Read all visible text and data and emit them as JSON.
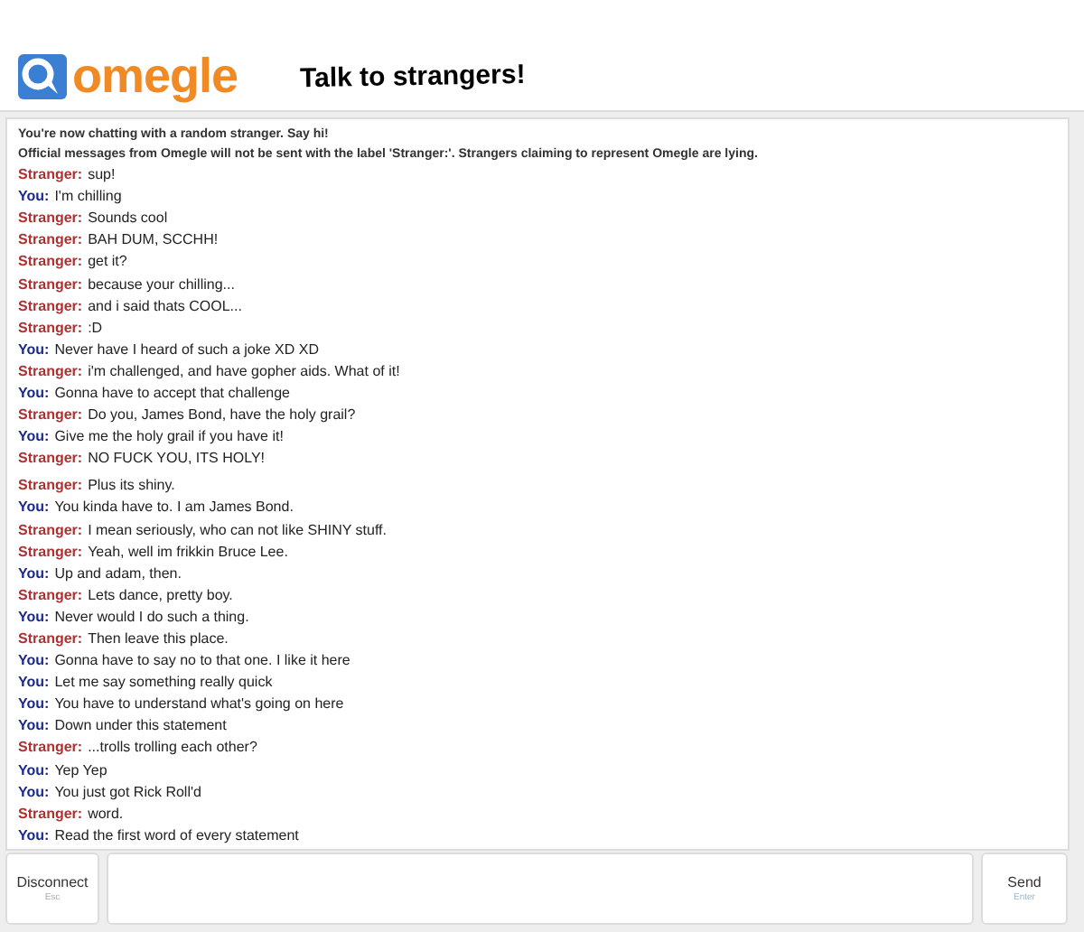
{
  "header": {
    "logo_text": "omegle",
    "tagline": "Talk to strangers!"
  },
  "system_messages": [
    "You're now chatting with a random stranger. Say hi!",
    "Official messages from Omegle will not be sent with the label 'Stranger:'. Strangers claiming to represent Omegle are lying."
  ],
  "messages": [
    {
      "kind": "stranger",
      "label": "Stranger:",
      "text": "sup!"
    },
    {
      "kind": "you",
      "label": "You:",
      "text": "I'm chilling"
    },
    {
      "kind": "stranger",
      "label": "Stranger:",
      "text": "Sounds cool"
    },
    {
      "kind": "stranger",
      "label": "Stranger:",
      "text": "BAH DUM, SCCHH!"
    },
    {
      "kind": "stranger",
      "label": "Stranger:",
      "text": "get it?"
    },
    {
      "kind": "stranger",
      "label": "Stranger:",
      "text": "because your chilling..."
    },
    {
      "kind": "stranger",
      "label": "Stranger:",
      "text": "and i said thats COOL..."
    },
    {
      "kind": "stranger",
      "label": "Stranger:",
      "text": ":D"
    },
    {
      "kind": "you",
      "label": "You:",
      "text": "Never have I heard of such a joke XD XD"
    },
    {
      "kind": "stranger",
      "label": "Stranger:",
      "text": "i'm challenged, and have gopher aids. What of it!"
    },
    {
      "kind": "you",
      "label": "You:",
      "text": "Gonna have to accept that challenge"
    },
    {
      "kind": "stranger",
      "label": "Stranger:",
      "text": "Do you, James Bond, have the holy grail?"
    },
    {
      "kind": "you",
      "label": "You:",
      "text": "Give me the holy grail if you have it!"
    },
    {
      "kind": "stranger",
      "label": "Stranger:",
      "text": "NO FUCK YOU, ITS HOLY!"
    },
    {
      "kind": "stranger",
      "label": "Stranger:",
      "text": "Plus its shiny."
    },
    {
      "kind": "you",
      "label": "You:",
      "text": "You kinda have to. I am James Bond."
    },
    {
      "kind": "stranger",
      "label": "Stranger:",
      "text": "I mean seriously, who can not like SHINY stuff."
    },
    {
      "kind": "stranger",
      "label": "Stranger:",
      "text": "Yeah, well im frikkin Bruce Lee."
    },
    {
      "kind": "you",
      "label": "You:",
      "text": "Up and adam, then."
    },
    {
      "kind": "stranger",
      "label": "Stranger:",
      "text": "Lets dance, pretty boy."
    },
    {
      "kind": "you",
      "label": "You:",
      "text": "Never would I do such a thing."
    },
    {
      "kind": "stranger",
      "label": "Stranger:",
      "text": "Then leave this place."
    },
    {
      "kind": "you",
      "label": "You:",
      "text": "Gonna have to say no to that one. I like it here"
    },
    {
      "kind": "you",
      "label": "You:",
      "text": "Let me say something really quick"
    },
    {
      "kind": "you",
      "label": "You:",
      "text": "You have to understand what's going on here"
    },
    {
      "kind": "you",
      "label": "You:",
      "text": "Down under this statement"
    },
    {
      "kind": "stranger",
      "label": "Stranger:",
      "text": "...trolls trolling each other?"
    },
    {
      "kind": "you",
      "label": "You:",
      "text": "Yep Yep"
    },
    {
      "kind": "you",
      "label": "You:",
      "text": "You just got Rick Roll'd"
    },
    {
      "kind": "stranger",
      "label": "Stranger:",
      "text": "word."
    },
    {
      "kind": "you",
      "label": "You:",
      "text": "Read the first word of every statement"
    }
  ],
  "disconnect_button": {
    "label": "Disconnect",
    "hint": "Esc"
  },
  "send_button": {
    "label": "Send",
    "hint": "Enter"
  }
}
